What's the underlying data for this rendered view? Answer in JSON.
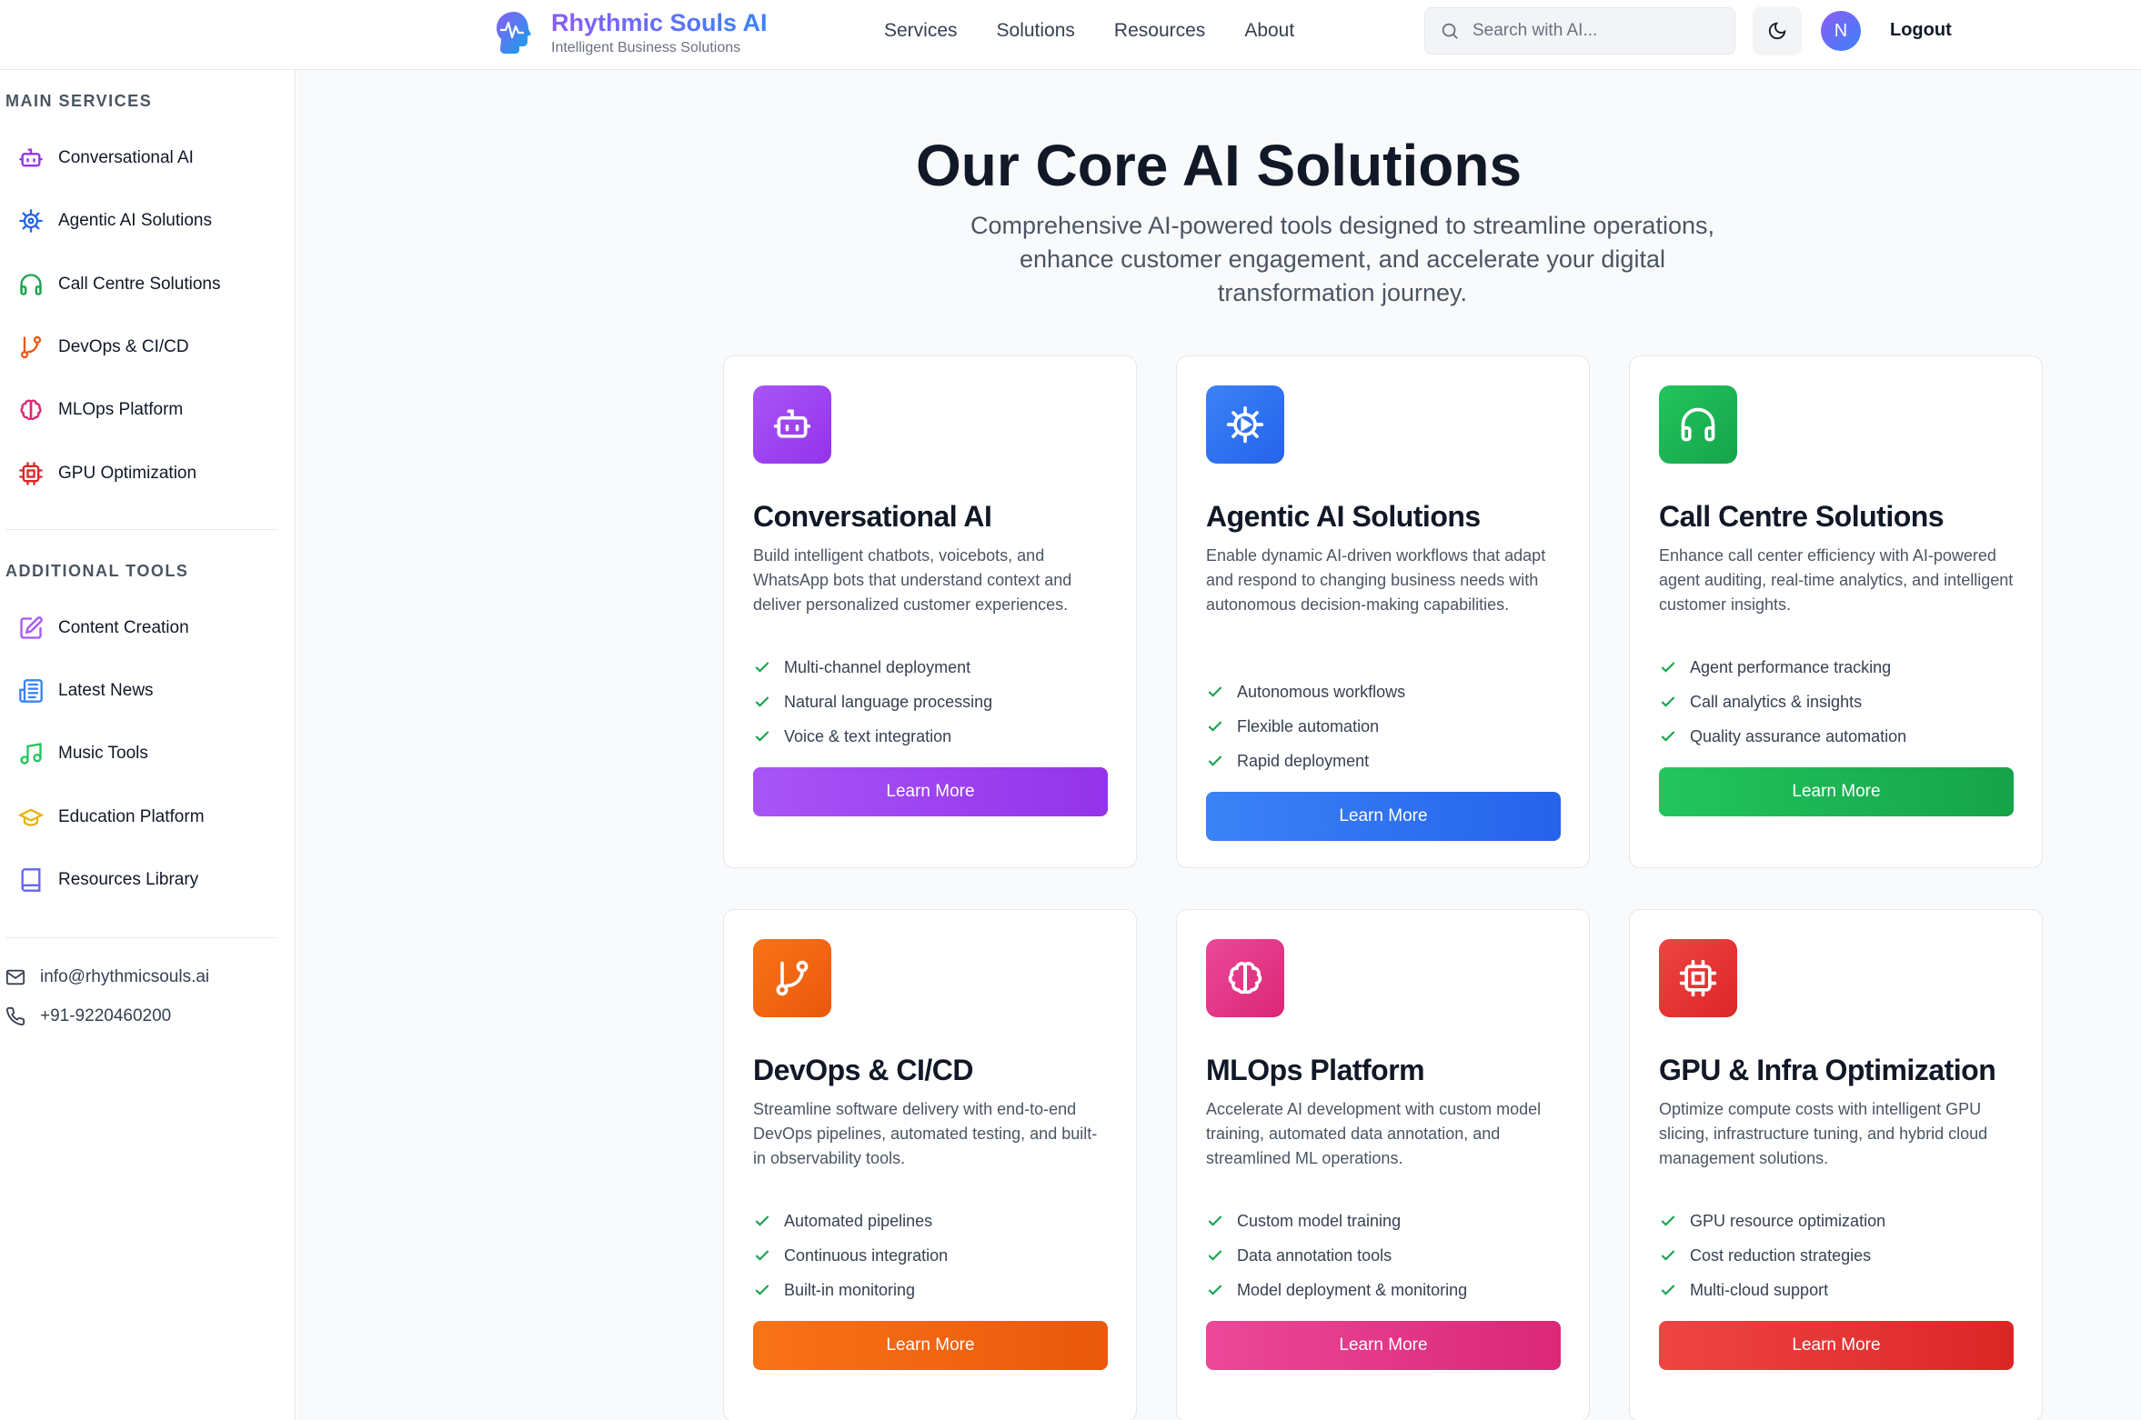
{
  "header": {
    "brand_name": "Rhythmic Souls AI",
    "brand_tagline": "Intelligent Business Solutions",
    "nav": [
      "Services",
      "Solutions",
      "Resources",
      "About"
    ],
    "search_placeholder": "Search with AI...",
    "avatar_initial": "N",
    "logout_label": "Logout"
  },
  "sidebar": {
    "main_heading": "MAIN SERVICES",
    "main_items": [
      {
        "label": "Conversational AI",
        "icon": "bot-icon",
        "color": "#9333ea"
      },
      {
        "label": "Agentic AI Solutions",
        "icon": "cog-icon",
        "color": "#2563eb"
      },
      {
        "label": "Call Centre Solutions",
        "icon": "headphones-icon",
        "color": "#16a34a"
      },
      {
        "label": "DevOps & CI/CD",
        "icon": "git-branch-icon",
        "color": "#ea580c"
      },
      {
        "label": "MLOps Platform",
        "icon": "brain-icon",
        "color": "#db2777"
      },
      {
        "label": "GPU Optimization",
        "icon": "cpu-icon",
        "color": "#dc2626"
      }
    ],
    "tools_heading": "ADDITIONAL TOOLS",
    "tool_items": [
      {
        "label": "Content Creation",
        "icon": "edit-icon",
        "color": "#a855f7"
      },
      {
        "label": "Latest News",
        "icon": "newspaper-icon",
        "color": "#3b82f6"
      },
      {
        "label": "Music Tools",
        "icon": "music-icon",
        "color": "#22c55e"
      },
      {
        "label": "Education Platform",
        "icon": "graduation-cap-icon",
        "color": "#eab308"
      },
      {
        "label": "Resources Library",
        "icon": "book-icon",
        "color": "#6366f1"
      }
    ],
    "email": "info@rhythmicsouls.ai",
    "phone": "+91-9220460200"
  },
  "hero": {
    "title": "Our Core AI Solutions",
    "subtitle": "Comprehensive AI-powered tools designed to streamline operations, enhance customer engagement, and accelerate your digital transformation journey."
  },
  "cards": [
    {
      "title": "Conversational AI",
      "icon": "bot-icon",
      "color_from": "#a855f7",
      "color_to": "#9333ea",
      "desc": "Build intelligent chatbots, voicebots, and WhatsApp bots that understand context and deliver personalized customer experiences.",
      "features": [
        "Multi-channel deployment",
        "Natural language processing",
        "Voice & text integration"
      ],
      "button": "Learn More"
    },
    {
      "title": "Agentic AI Solutions",
      "icon": "cog-icon",
      "color_from": "#3b82f6",
      "color_to": "#2563eb",
      "desc": "Enable dynamic AI-driven workflows that adapt and respond to changing business needs with autonomous decision-making capabilities.",
      "features": [
        "Autonomous workflows",
        "Flexible automation",
        "Rapid deployment"
      ],
      "button": "Learn More"
    },
    {
      "title": "Call Centre Solutions",
      "icon": "headphones-icon",
      "color_from": "#22c55e",
      "color_to": "#16a34a",
      "desc": "Enhance call center efficiency with AI-powered agent auditing, real-time analytics, and intelligent customer insights.",
      "features": [
        "Agent performance tracking",
        "Call analytics & insights",
        "Quality assurance automation"
      ],
      "button": "Learn More"
    },
    {
      "title": "DevOps & CI/CD",
      "icon": "git-branch-icon",
      "color_from": "#f97316",
      "color_to": "#ea580c",
      "desc": "Streamline software delivery with end-to-end DevOps pipelines, automated testing, and built-in observability tools.",
      "features": [
        "Automated pipelines",
        "Continuous integration",
        "Built-in monitoring"
      ],
      "button": "Learn More"
    },
    {
      "title": "MLOps Platform",
      "icon": "brain-icon",
      "color_from": "#ec4899",
      "color_to": "#db2777",
      "desc": "Accelerate AI development with custom model training, automated data annotation, and streamlined ML operations.",
      "features": [
        "Custom model training",
        "Data annotation tools",
        "Model deployment & monitoring"
      ],
      "button": "Learn More"
    },
    {
      "title": "GPU & Infra Optimization",
      "icon": "cpu-icon",
      "color_from": "#ef4444",
      "color_to": "#dc2626",
      "desc": "Optimize compute costs with intelligent GPU slicing, infrastructure tuning, and hybrid cloud management solutions.",
      "features": [
        "GPU resource optimization",
        "Cost reduction strategies",
        "Multi-cloud support"
      ],
      "button": "Learn More"
    }
  ]
}
